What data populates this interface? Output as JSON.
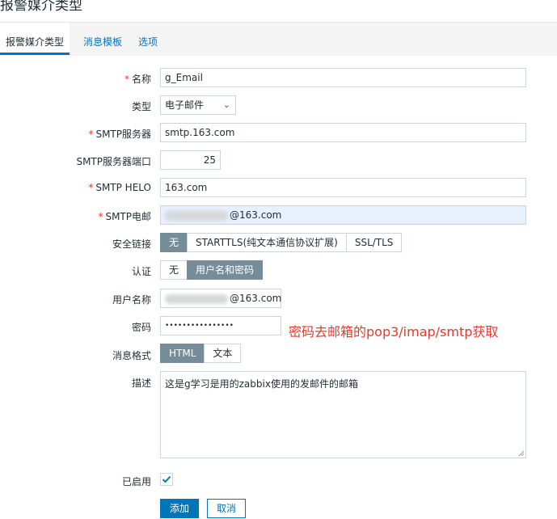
{
  "page": {
    "title": "报警媒介类型"
  },
  "tabs": [
    {
      "label": "报警媒介类型",
      "active": true
    },
    {
      "label": "消息模板",
      "active": false
    },
    {
      "label": "选项",
      "active": false
    }
  ],
  "form": {
    "name": {
      "label": "名称",
      "value": "g_Email",
      "required": true
    },
    "type": {
      "label": "类型",
      "value": "电子邮件"
    },
    "smtp_server": {
      "label": "SMTP服务器",
      "value": "smtp.163.com",
      "required": true
    },
    "smtp_port": {
      "label": "SMTP服务器端口",
      "value": "25"
    },
    "smtp_helo": {
      "label": "SMTP HELO",
      "value": "163.com",
      "required": true
    },
    "smtp_email": {
      "label": "SMTP电邮",
      "value": "@163.com",
      "required": true
    },
    "security": {
      "label": "安全链接",
      "options": [
        "无",
        "STARTTLS(纯文本通信协议扩展)",
        "SSL/TLS"
      ],
      "selected": "无"
    },
    "auth": {
      "label": "认证",
      "options": [
        "无",
        "用户名和密码"
      ],
      "selected": "用户名和密码"
    },
    "username": {
      "label": "用户名称",
      "value": "@163.com"
    },
    "password": {
      "label": "密码",
      "value": "••••••••••••••••"
    },
    "message_format": {
      "label": "消息格式",
      "options": [
        "HTML",
        "文本"
      ],
      "selected": "HTML"
    },
    "description": {
      "label": "描述",
      "value": "这是g学习是用的zabbix使用的发邮件的邮箱"
    },
    "enabled": {
      "label": "已启用",
      "checked": true
    }
  },
  "annotation": {
    "text": "密码去邮箱的pop3/imap/smtp获取",
    "color": "#e8392b"
  },
  "buttons": {
    "add": "添加",
    "cancel": "取消"
  },
  "colors": {
    "accent": "#0275b8",
    "segment_active": "#768d99",
    "required": "#e33734"
  }
}
